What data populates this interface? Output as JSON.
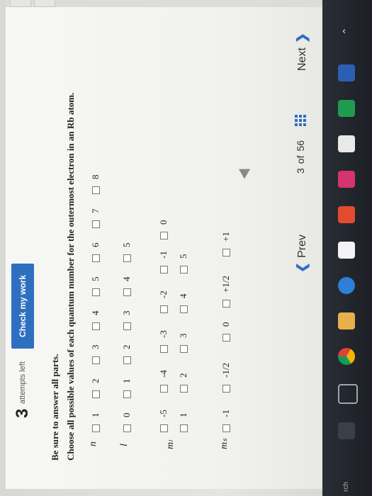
{
  "header": {
    "attempts_count": "3",
    "attempts_label": "attempts left",
    "check_button": "Check my work"
  },
  "instructions": {
    "line1": "Be sure to answer all parts.",
    "line2": "Choose all possible values of each quantum number for the outermost electron in an Rb atom."
  },
  "rows": [
    {
      "label": "n",
      "options": [
        "1",
        "2",
        "3",
        "4",
        "5",
        "6",
        "7",
        "8"
      ]
    },
    {
      "label": "l",
      "options": [
        "0",
        "1",
        "2",
        "3",
        "4",
        "5"
      ]
    },
    {
      "label": "m_l",
      "options_line1": [
        "-5",
        "-4",
        "-3",
        "-2",
        "-1",
        "0"
      ],
      "options_line2": [
        "1",
        "2",
        "3",
        "4",
        "5"
      ]
    },
    {
      "label": "m_s",
      "options": [
        "-1",
        "-1/2",
        "0",
        "+1/2",
        "+1"
      ]
    }
  ],
  "row_labels": {
    "n": "n",
    "l": "l",
    "ml": "mₗ",
    "ms": "mₛ"
  },
  "nav": {
    "prev": "Prev",
    "page_current": "3",
    "page_of": "of",
    "page_total": "56",
    "next": "Next"
  },
  "taskbar": {
    "search_fragment": "rch"
  },
  "colors": {
    "accent": "#2f6fc0",
    "taskbar": "#1f232a"
  }
}
